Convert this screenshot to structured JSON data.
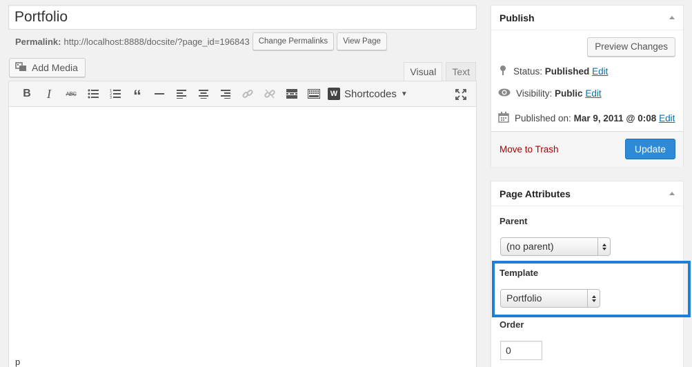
{
  "page_title": "Portfolio",
  "permalink": {
    "label": "Permalink:",
    "url": "http://localhost:8888/docsite/?page_id=196843",
    "change_button": "Change Permalinks",
    "view_button": "View Page"
  },
  "add_media_label": "Add Media",
  "editor_tabs": {
    "visual": "Visual",
    "text": "Text"
  },
  "toolbar": {
    "shortcodes_label": "Shortcodes",
    "w_logo": "W"
  },
  "editor_status": "p",
  "publish": {
    "title": "Publish",
    "preview_button": "Preview Changes",
    "status_label": "Status:",
    "status_value": "Published",
    "visibility_label": "Visibility:",
    "visibility_value": "Public",
    "published_label": "Published on:",
    "published_value": "Mar 9, 2011 @ 0:08",
    "edit_link": "Edit",
    "trash_link": "Move to Trash",
    "update_button": "Update"
  },
  "page_attributes": {
    "title": "Page Attributes",
    "parent_label": "Parent",
    "parent_value": "(no parent)",
    "template_label": "Template",
    "template_value": "Portfolio",
    "order_label": "Order",
    "order_value": "0"
  },
  "colors": {
    "accent": "#2e8ad6",
    "highlight": "#1e7fd6",
    "trash": "#aa0000",
    "link": "#0073aa"
  }
}
